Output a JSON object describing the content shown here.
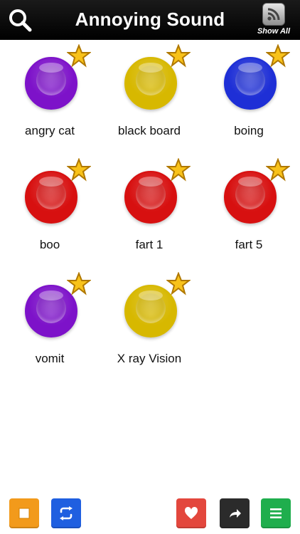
{
  "header": {
    "title": "Annoying Sound",
    "show_all_label": "Show All"
  },
  "sounds": [
    {
      "label": "angry cat",
      "color": "#7d12c9"
    },
    {
      "label": "black board",
      "color": "#d7b800"
    },
    {
      "label": "boing",
      "color": "#1e2fd6"
    },
    {
      "label": "boo",
      "color": "#d71010"
    },
    {
      "label": "fart 1",
      "color": "#d71010"
    },
    {
      "label": "fart 5",
      "color": "#d71010"
    },
    {
      "label": "vomit",
      "color": "#7d12c9"
    },
    {
      "label": "X ray Vision",
      "color": "#d7b800"
    }
  ],
  "bottom_bar": {
    "stop": {
      "color": "#f29a1b",
      "icon": "stop-icon"
    },
    "repeat": {
      "color": "#1f5fe0",
      "icon": "repeat-icon"
    },
    "favorite": {
      "color": "#e3473d",
      "icon": "heart-icon"
    },
    "share": {
      "color": "#2b2b2b",
      "icon": "share-icon"
    },
    "menu": {
      "color": "#1fae4d",
      "icon": "menu-icon"
    }
  }
}
